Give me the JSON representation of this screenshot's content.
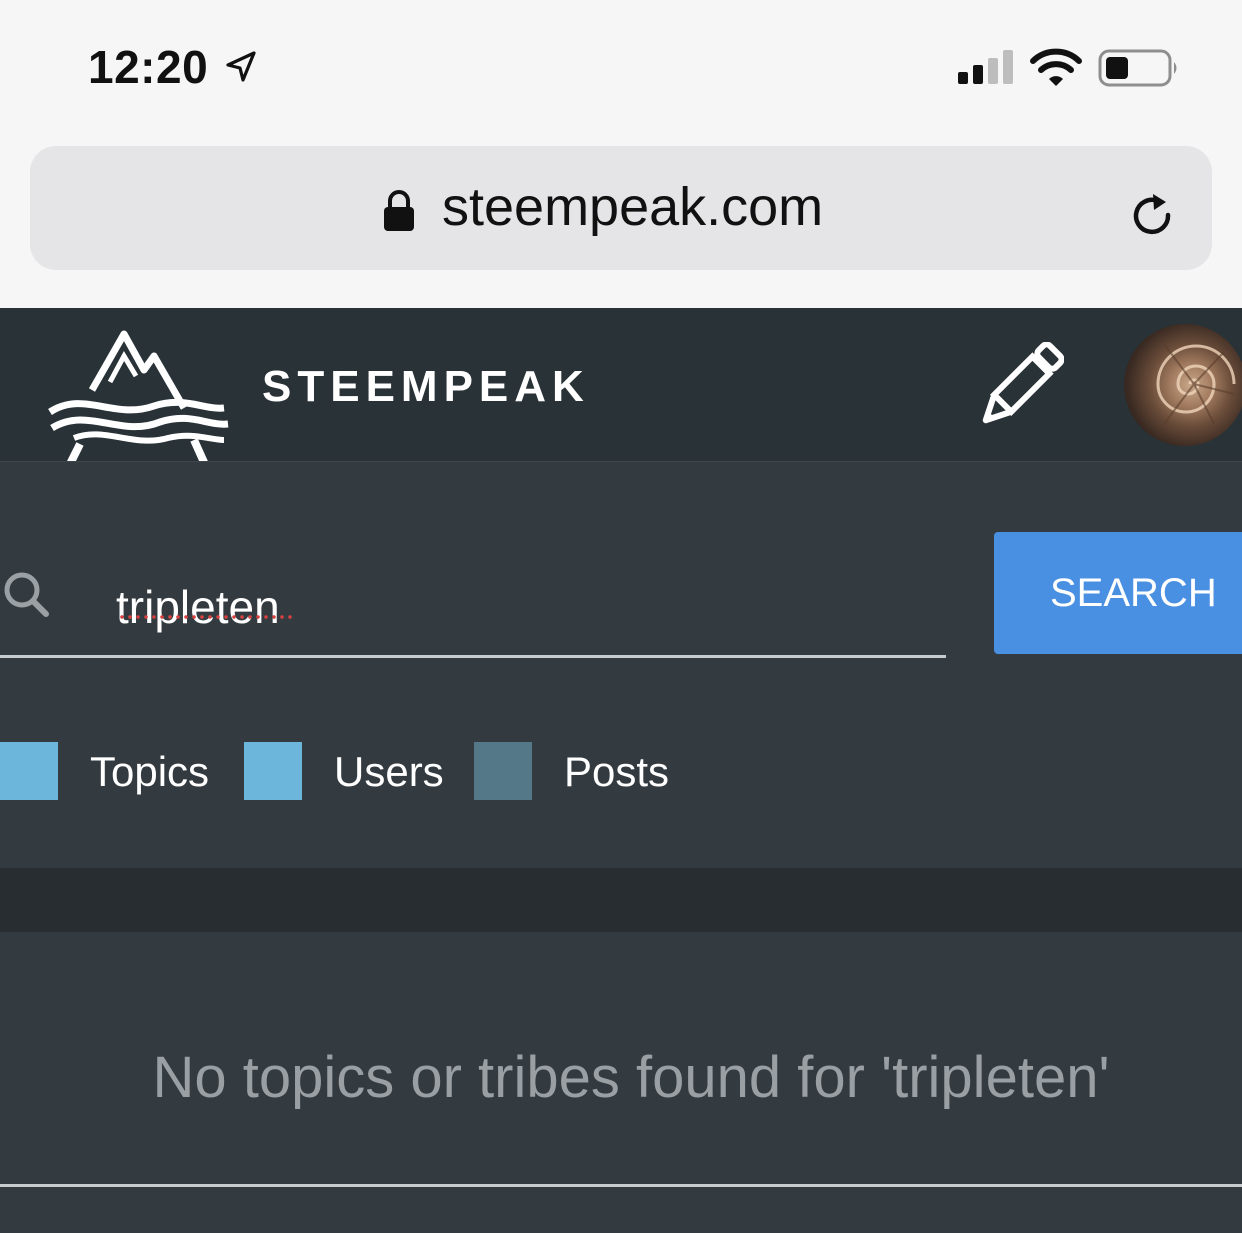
{
  "status_bar": {
    "time": "12:20",
    "icons": [
      "location-arrow-icon",
      "signal-icon",
      "wifi-icon",
      "battery-icon"
    ]
  },
  "browser": {
    "url": "steempeak.com",
    "icons": [
      "lock-icon",
      "reload-icon"
    ]
  },
  "header": {
    "brand": "STEEMPEAK",
    "icons": [
      "steempeak-logo-icon",
      "pencil-icon",
      "avatar"
    ]
  },
  "search": {
    "query": "tripleten",
    "button_label": "SEARCH"
  },
  "filters": [
    {
      "label": "Topics",
      "checked": true
    },
    {
      "label": "Users",
      "checked": true
    },
    {
      "label": "Posts",
      "checked": false
    }
  ],
  "results": {
    "empty_message": "No topics or tribes found for 'tripleten'"
  },
  "colors": {
    "header_bg": "#283237",
    "panel_bg": "#343b40",
    "accent": "#4a90e2",
    "checkbox_on": "#6bb6da",
    "checkbox_off": "#557888"
  }
}
